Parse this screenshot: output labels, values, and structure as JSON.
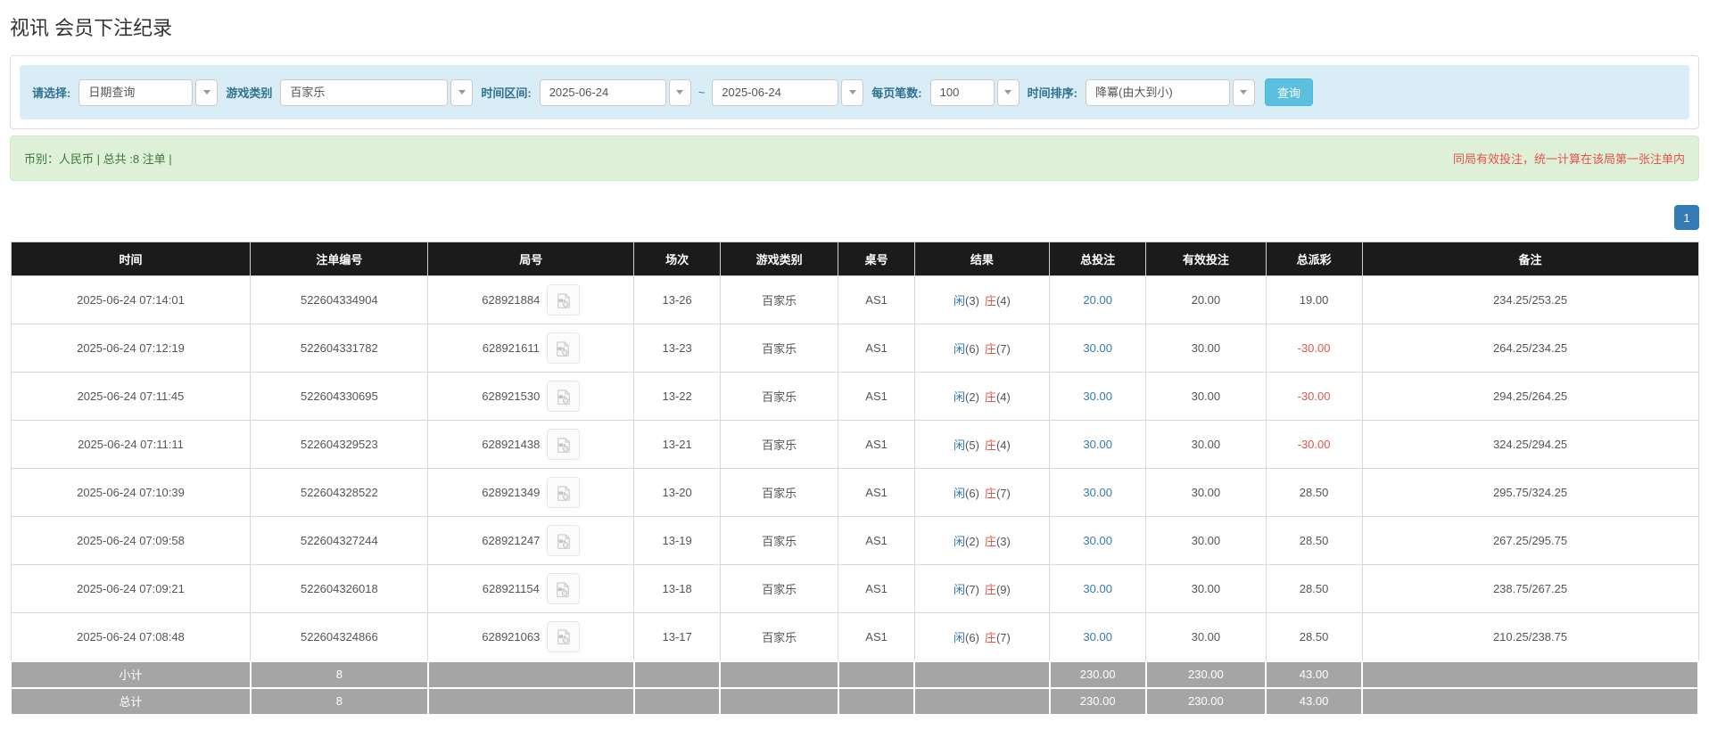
{
  "page": {
    "title": "视讯 会员下注纪录"
  },
  "filters": {
    "query_type": {
      "label": "请选择:",
      "value": "日期查询"
    },
    "game_type": {
      "label": "游戏类别",
      "value": "百家乐"
    },
    "time_range": {
      "label": "时间区间:",
      "from": "2025-06-24",
      "separator": "~",
      "to": "2025-06-24"
    },
    "page_size": {
      "label": "每页笔数:",
      "value": "100"
    },
    "sort": {
      "label": "时间排序:",
      "value": "降冪(由大到小)"
    },
    "search_button_label": "查询"
  },
  "summary": {
    "left": "币别：人民币 | 总共 :8 注单 |",
    "right": "同局有效投注，统一计算在该局第一张注单内"
  },
  "pagination": {
    "current_page": "1"
  },
  "table": {
    "headers": [
      "时间",
      "注单编号",
      "局号",
      "场次",
      "游戏类别",
      "桌号",
      "结果",
      "总投注",
      "有效投注",
      "总派彩",
      "备注"
    ],
    "rows": [
      {
        "time": "2025-06-24 07:14:01",
        "bet_id": "522604334904",
        "round_id": "628921884",
        "session": "13-26",
        "game": "百家乐",
        "table_no": "AS1",
        "result": {
          "player": "闲",
          "player_score": "(3)",
          "banker": "庄",
          "banker_score": "(4)"
        },
        "total_bet": "20.00",
        "valid_bet": "20.00",
        "payout": "19.00",
        "remark": "234.25/253.25"
      },
      {
        "time": "2025-06-24 07:12:19",
        "bet_id": "522604331782",
        "round_id": "628921611",
        "session": "13-23",
        "game": "百家乐",
        "table_no": "AS1",
        "result": {
          "player": "闲",
          "player_score": "(6)",
          "banker": "庄",
          "banker_score": "(7)"
        },
        "total_bet": "30.00",
        "valid_bet": "30.00",
        "payout": "-30.00",
        "remark": "264.25/234.25"
      },
      {
        "time": "2025-06-24 07:11:45",
        "bet_id": "522604330695",
        "round_id": "628921530",
        "session": "13-22",
        "game": "百家乐",
        "table_no": "AS1",
        "result": {
          "player": "闲",
          "player_score": "(2)",
          "banker": "庄",
          "banker_score": "(4)"
        },
        "total_bet": "30.00",
        "valid_bet": "30.00",
        "payout": "-30.00",
        "remark": "294.25/264.25"
      },
      {
        "time": "2025-06-24 07:11:11",
        "bet_id": "522604329523",
        "round_id": "628921438",
        "session": "13-21",
        "game": "百家乐",
        "table_no": "AS1",
        "result": {
          "player": "闲",
          "player_score": "(5)",
          "banker": "庄",
          "banker_score": "(4)"
        },
        "total_bet": "30.00",
        "valid_bet": "30.00",
        "payout": "-30.00",
        "remark": "324.25/294.25"
      },
      {
        "time": "2025-06-24 07:10:39",
        "bet_id": "522604328522",
        "round_id": "628921349",
        "session": "13-20",
        "game": "百家乐",
        "table_no": "AS1",
        "result": {
          "player": "闲",
          "player_score": "(6)",
          "banker": "庄",
          "banker_score": "(7)"
        },
        "total_bet": "30.00",
        "valid_bet": "30.00",
        "payout": "28.50",
        "remark": "295.75/324.25"
      },
      {
        "time": "2025-06-24 07:09:58",
        "bet_id": "522604327244",
        "round_id": "628921247",
        "session": "13-19",
        "game": "百家乐",
        "table_no": "AS1",
        "result": {
          "player": "闲",
          "player_score": "(2)",
          "banker": "庄",
          "banker_score": "(3)"
        },
        "total_bet": "30.00",
        "valid_bet": "30.00",
        "payout": "28.50",
        "remark": "267.25/295.75"
      },
      {
        "time": "2025-06-24 07:09:21",
        "bet_id": "522604326018",
        "round_id": "628921154",
        "session": "13-18",
        "game": "百家乐",
        "table_no": "AS1",
        "result": {
          "player": "闲",
          "player_score": "(7)",
          "banker": "庄",
          "banker_score": "(9)"
        },
        "total_bet": "30.00",
        "valid_bet": "30.00",
        "payout": "28.50",
        "remark": "238.75/267.25"
      },
      {
        "time": "2025-06-24 07:08:48",
        "bet_id": "522604324866",
        "round_id": "628921063",
        "session": "13-17",
        "game": "百家乐",
        "table_no": "AS1",
        "result": {
          "player": "闲",
          "player_score": "(6)",
          "banker": "庄",
          "banker_score": "(7)"
        },
        "total_bet": "30.00",
        "valid_bet": "30.00",
        "payout": "28.50",
        "remark": "210.25/238.75"
      }
    ],
    "footer_rows": [
      {
        "label": "小计",
        "count": "8",
        "total_bet": "230.00",
        "valid_bet": "230.00",
        "payout": "43.00"
      },
      {
        "label": "总计",
        "count": "8",
        "total_bet": "230.00",
        "valid_bet": "230.00",
        "payout": "43.00"
      }
    ]
  },
  "colors": {
    "header_bg": "#1b1b1b",
    "footer_bg": "#a5a5a5",
    "link_blue": "#337ab7",
    "player_blue": "#337ab7",
    "banker_red": "#e0544c",
    "negative_red": "#e0544c",
    "alert_bg": "#dff0d8",
    "alert_text": "#3c763d",
    "filter_bar_bg": "#d9edf7",
    "search_button_bg": "#5bc0de",
    "pager_bg": "#337ab7"
  }
}
